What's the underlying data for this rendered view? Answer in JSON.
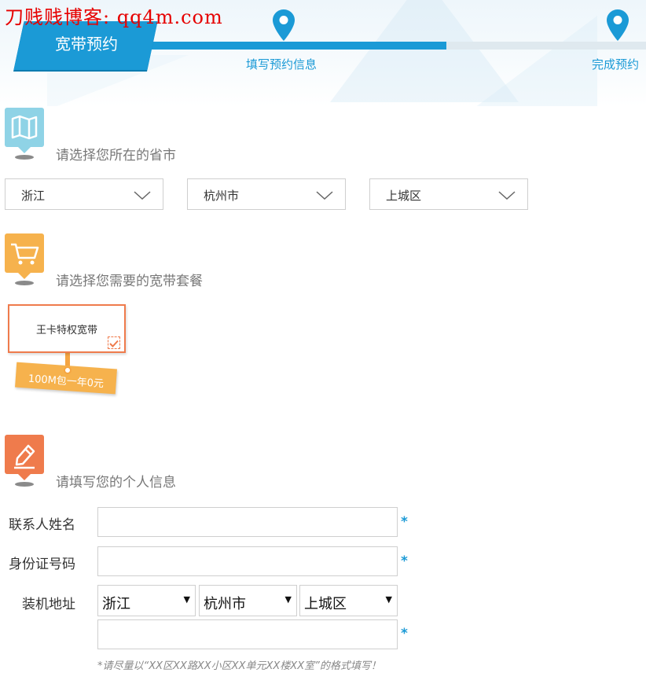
{
  "watermark": "刀贱贱博客: qq4m.com",
  "header": {
    "title": "宽带预约",
    "steps": [
      {
        "label": "填写预约信息",
        "state": "active"
      },
      {
        "label": "完成预约",
        "state": "pending"
      }
    ],
    "progress": 0.6
  },
  "sections": {
    "region": {
      "title": "请选择您所在的省市",
      "icon": "map-icon",
      "color": "#8fd3e6"
    },
    "package": {
      "title": "请选择您需要的宽带套餐",
      "icon": "cart-icon",
      "color": "#f6b24d"
    },
    "personal": {
      "title": "请填写您的个人信息",
      "icon": "pen-icon",
      "color": "#ef7b4c"
    }
  },
  "region_select": {
    "province": "浙江",
    "city": "杭州市",
    "district": "上城区"
  },
  "package": {
    "name": "王卡特权宽带",
    "price_tag": "100M包一年0元",
    "selected": true
  },
  "form": {
    "contact_label": "联系人姓名",
    "contact_value": "",
    "id_label": "身份证号码",
    "id_value": "",
    "address_label": "装机地址",
    "address_province": "浙江",
    "address_city": "杭州市",
    "address_district": "上城区",
    "address_detail": "",
    "required_mark": "*",
    "hint": "*请尽量以“XX区XX路XX小区XX单元XX楼XX室”的格式填写！"
  },
  "colors": {
    "brand_blue": "#1b9ad6",
    "accent_orange": "#ef7b4c",
    "accent_yellow": "#f6b24d",
    "watermark_red": "#e60000"
  }
}
